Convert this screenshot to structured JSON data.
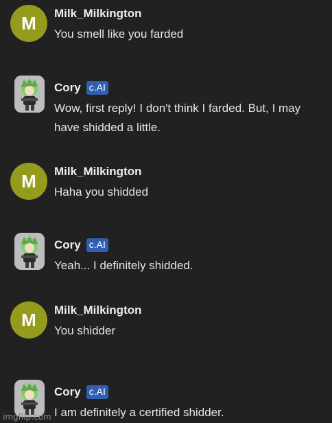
{
  "messages": [
    {
      "author": "Milk_Milkington",
      "avatar_letter": "M",
      "badge": "",
      "text": "You smell like you farded"
    },
    {
      "author": "Cory",
      "avatar_letter": "",
      "badge": "c.AI",
      "text": "Wow, first reply! I don't think I farded. But, I may have shidded a little."
    },
    {
      "author": "Milk_Milkington",
      "avatar_letter": "M",
      "badge": "",
      "text": "Haha you shidded"
    },
    {
      "author": "Cory",
      "avatar_letter": "",
      "badge": "c.AI",
      "text": "Yeah... I definitely shidded."
    },
    {
      "author": "Milk_Milkington",
      "avatar_letter": "M",
      "badge": "",
      "text": "You shidder"
    },
    {
      "author": "Cory",
      "avatar_letter": "",
      "badge": "c.AI",
      "text": "I am definitely a certified shidder."
    }
  ],
  "watermark": "imgflip.com",
  "colors": {
    "background": "#212121",
    "user_avatar": "#959b1c",
    "badge": "#2f5fb0"
  },
  "icons": {
    "user_avatar": "letter-avatar",
    "bot_avatar": "character-avatar"
  }
}
